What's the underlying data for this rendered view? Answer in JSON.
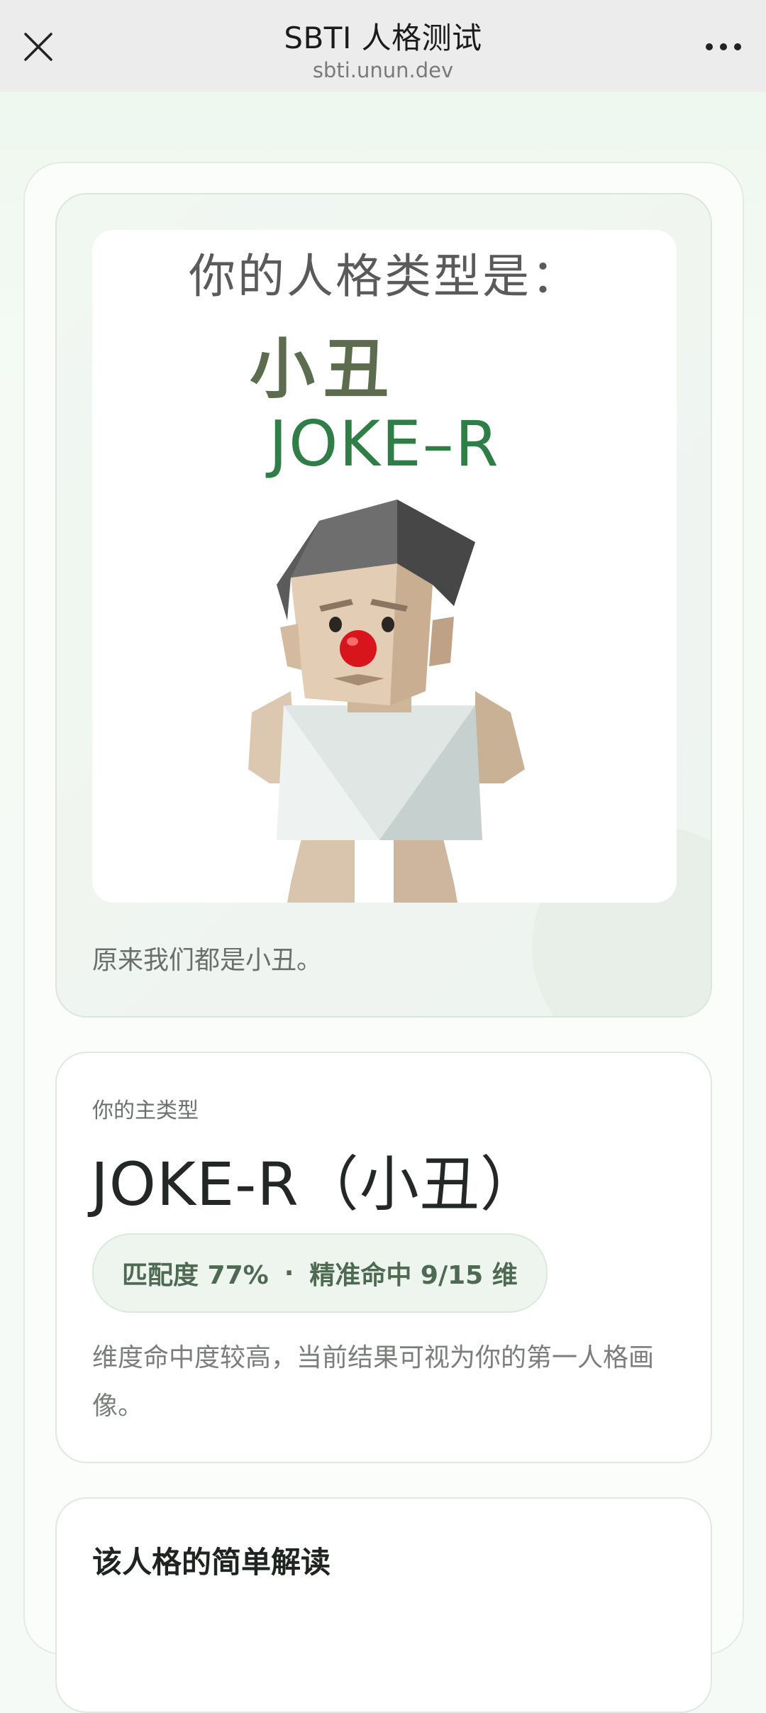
{
  "topbar": {
    "title": "SBTI 人格测试",
    "url": "sbti.unun.dev",
    "close_icon": "close-icon",
    "more_icon": "more-horizontal-icon"
  },
  "result_image": {
    "heading": "你的人格类型是：",
    "name": "小丑",
    "code": "JOKE–R",
    "character_icon": "clown-character-illustration"
  },
  "caption": "原来我们都是小丑。",
  "main_type": {
    "label": "你的主类型",
    "name": "JOKE-R（小丑）",
    "match_text": "匹配度 77%",
    "dot": "·",
    "hit_text": "精准命中 9/15 维",
    "description": "维度命中度较高，当前结果可视为你的第一人格画像。"
  },
  "interpretation": {
    "title": "该人格的简单解读"
  },
  "colors": {
    "accent_green": "#2f7d47",
    "pill_text": "#4e6a52",
    "nose_red": "#d8141c"
  }
}
